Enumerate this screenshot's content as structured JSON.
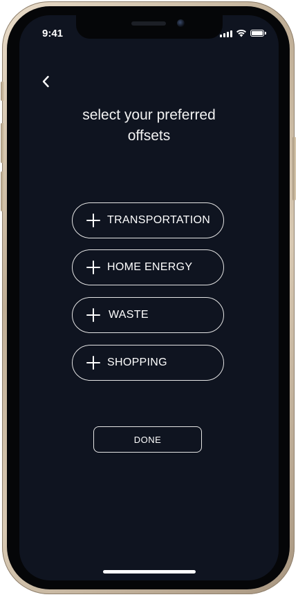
{
  "status_bar": {
    "time": "9:41",
    "icons": [
      "signal-icon",
      "wifi-icon",
      "battery-icon"
    ]
  },
  "nav": {
    "back_icon": "chevron-left-icon"
  },
  "main": {
    "title": "select your preferred offsets",
    "options": [
      {
        "label": "TRANSPORTATION",
        "icon": "plus-icon"
      },
      {
        "label": "HOME ENERGY",
        "icon": "plus-icon"
      },
      {
        "label": "WASTE",
        "icon": "plus-icon"
      },
      {
        "label": "SHOPPING",
        "icon": "plus-icon"
      }
    ],
    "done_label": "DONE"
  },
  "colors": {
    "background": "#0f1420",
    "text": "#ffffff",
    "outline": "#e6e6e6"
  }
}
